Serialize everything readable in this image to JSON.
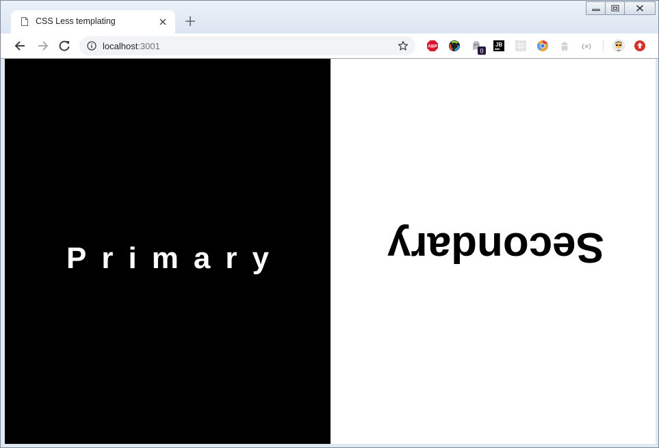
{
  "browser": {
    "tab": {
      "title": "CSS Less templating",
      "icon": "page-icon"
    },
    "new_tab_icon": "plus-icon",
    "window_controls": [
      "minimize-icon",
      "restore-icon",
      "close-icon"
    ],
    "nav": {
      "back_icon": "back-arrow-icon",
      "forward_icon": "forward-arrow-icon",
      "reload_icon": "reload-icon"
    },
    "address": {
      "host": "localhost",
      "port": ":3001",
      "info_icon": "info-icon",
      "bookmark_icon": "star-icon"
    },
    "extensions": [
      {
        "name": "adblock-plus-icon",
        "label": "ABP",
        "color": "#d7172f"
      },
      {
        "name": "color-wheel-icon",
        "label": "",
        "color": "#222222"
      },
      {
        "name": "ghostery-icon",
        "label": "",
        "badge": "0",
        "color": "#8a8f96"
      },
      {
        "name": "jetbrains-icon",
        "label": "JB",
        "color": "#000000"
      },
      {
        "name": "grid-extension-icon",
        "label": "",
        "color": "#cfcfcf"
      },
      {
        "name": "chrome-dev-icon",
        "label": "",
        "color": "#e8a33d"
      },
      {
        "name": "android-icon",
        "label": "",
        "color": "#cfcfcf"
      },
      {
        "name": "json-viewer-icon",
        "label": "{≡}",
        "color": "#777777"
      },
      {
        "name": "profile-avatar-icon",
        "label": "",
        "color": "#f3c36b"
      },
      {
        "name": "update-icon",
        "label": "",
        "color": "#d93025"
      }
    ]
  },
  "page": {
    "primary": {
      "text": "Primary",
      "background": "#000000",
      "color": "#ffffff"
    },
    "secondary": {
      "text": "Secondary",
      "background": "#ffffff",
      "color": "#000000",
      "orientation": "upside-down"
    }
  }
}
